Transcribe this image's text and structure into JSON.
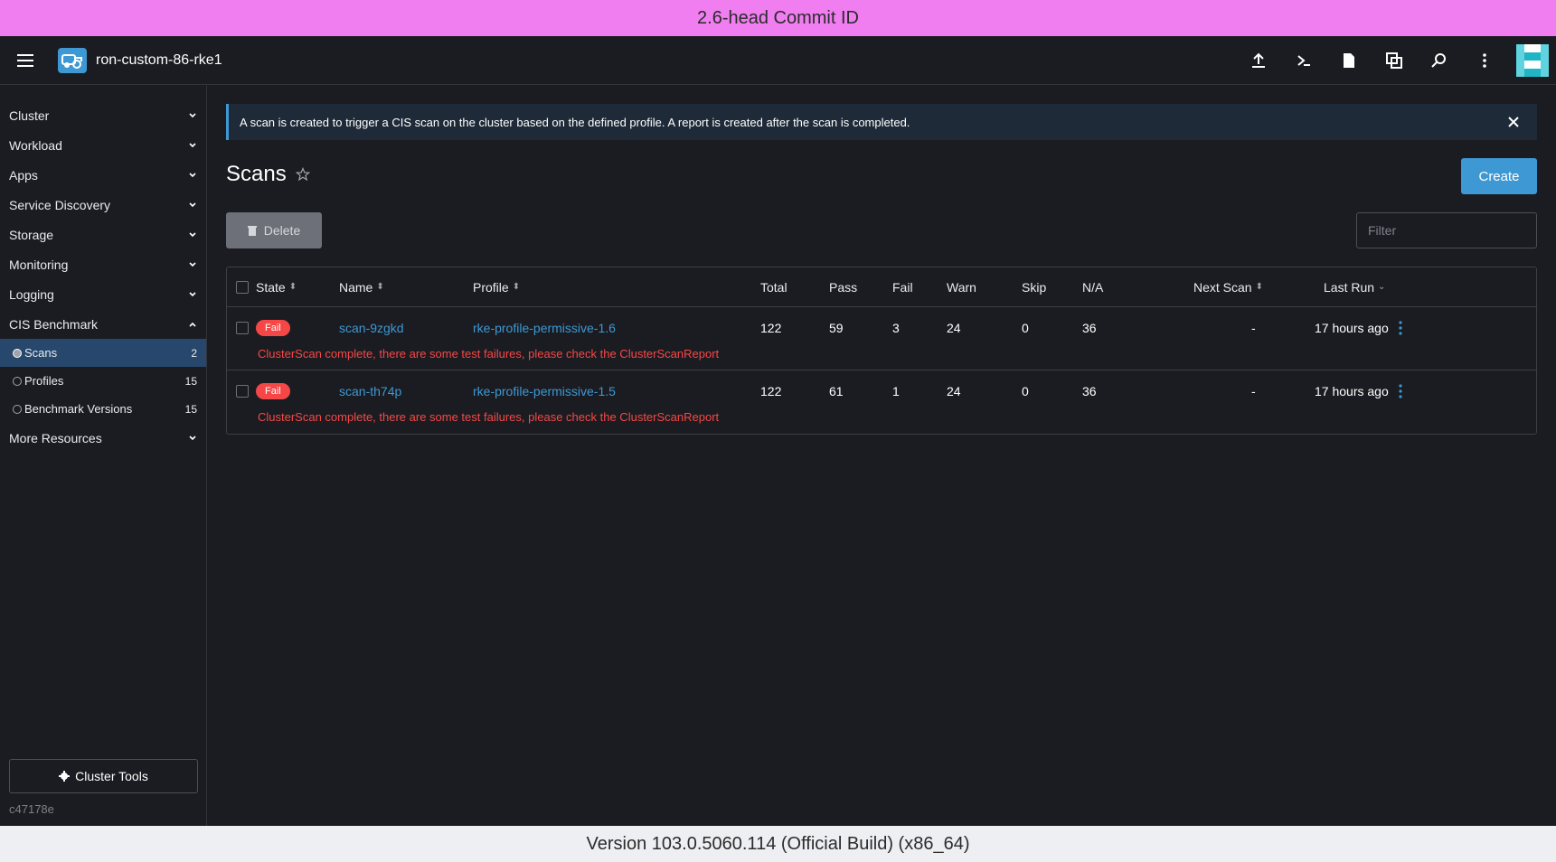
{
  "top_banner": "2.6-head Commit ID",
  "bottom_banner": "Version 103.0.5060.114 (Official Build) (x86_64)",
  "header": {
    "cluster_name": "ron-custom-86-rke1"
  },
  "sidebar": {
    "groups": [
      {
        "label": "Cluster"
      },
      {
        "label": "Workload"
      },
      {
        "label": "Apps"
      },
      {
        "label": "Service Discovery"
      },
      {
        "label": "Storage"
      },
      {
        "label": "Monitoring"
      },
      {
        "label": "Logging"
      },
      {
        "label": "CIS Benchmark"
      }
    ],
    "cis_children": [
      {
        "label": "Scans",
        "count": "2"
      },
      {
        "label": "Profiles",
        "count": "15"
      },
      {
        "label": "Benchmark Versions",
        "count": "15"
      }
    ],
    "more_resources": "More Resources",
    "cluster_tools": "Cluster Tools",
    "build_hash": "c47178e"
  },
  "main": {
    "info_banner": "A scan is created to trigger a CIS scan on the cluster based on the defined profile. A report is created after the scan is completed.",
    "title": "Scans",
    "create_label": "Create",
    "delete_label": "Delete",
    "filter_placeholder": "Filter",
    "columns": {
      "state": "State",
      "name": "Name",
      "profile": "Profile",
      "total": "Total",
      "pass": "Pass",
      "fail": "Fail",
      "warn": "Warn",
      "skip": "Skip",
      "na": "N/A",
      "next_scan": "Next Scan",
      "last_run": "Last Run"
    },
    "rows": [
      {
        "state": "Fail",
        "name": "scan-9zgkd",
        "profile": "rke-profile-permissive-1.6",
        "total": "122",
        "pass": "59",
        "fail": "3",
        "warn": "24",
        "skip": "0",
        "na": "36",
        "next_scan": "-",
        "last_run": "17 hours ago",
        "message": "ClusterScan complete, there are some test failures, please check the ClusterScanReport"
      },
      {
        "state": "Fail",
        "name": "scan-th74p",
        "profile": "rke-profile-permissive-1.5",
        "total": "122",
        "pass": "61",
        "fail": "1",
        "warn": "24",
        "skip": "0",
        "na": "36",
        "next_scan": "-",
        "last_run": "17 hours ago",
        "message": "ClusterScan complete, there are some test failures, please check the ClusterScanReport"
      }
    ]
  },
  "colors": {
    "accent": "#3d98d3",
    "fail": "#f64747",
    "active_nav": "#27486c",
    "top_banner_bg": "#f07ef0"
  }
}
